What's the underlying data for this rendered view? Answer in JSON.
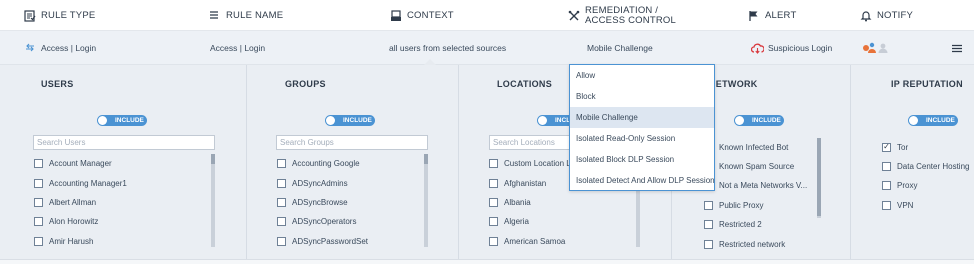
{
  "header": {
    "rule_type": "RULE TYPE",
    "rule_name": "RULE NAME",
    "context": "CONTEXT",
    "remediation_line1": "REMEDIATION /",
    "remediation_line2": "ACCESS CONTROL",
    "alert": "ALERT",
    "notify": "NOTIFY"
  },
  "rule": {
    "type": "Access | Login",
    "name": "Access | Login",
    "context": "all users from selected sources",
    "remediation": "Mobile Challenge",
    "alert": "Suspicious Login"
  },
  "columns": {
    "users": {
      "title": "USERS",
      "toggle": "INCLUDE",
      "search_placeholder": "Search Users",
      "items": [
        {
          "label": "Account Manager",
          "checked": false
        },
        {
          "label": "Accounting Manager1",
          "checked": false
        },
        {
          "label": "Albert Allman",
          "checked": false
        },
        {
          "label": "Alon Horowitz",
          "checked": false
        },
        {
          "label": "Amir Harush",
          "checked": false
        }
      ]
    },
    "groups": {
      "title": "GROUPS",
      "toggle": "INCLUDE",
      "search_placeholder": "Search Groups",
      "items": [
        {
          "label": "Accounting Google",
          "checked": false
        },
        {
          "label": "ADSyncAdmins",
          "checked": false
        },
        {
          "label": "ADSyncBrowse",
          "checked": false
        },
        {
          "label": "ADSyncOperators",
          "checked": false
        },
        {
          "label": "ADSyncPasswordSet",
          "checked": false
        }
      ]
    },
    "locations": {
      "title": "LOCATIONS",
      "toggle": "INCLUDE",
      "search_placeholder": "Search Locations",
      "items": [
        {
          "label": "Custom Location L",
          "checked": false
        },
        {
          "label": "Afghanistan",
          "checked": false
        },
        {
          "label": "Albania",
          "checked": false
        },
        {
          "label": "Algeria",
          "checked": false
        },
        {
          "label": "American Samoa",
          "checked": false
        }
      ]
    },
    "network": {
      "title": "NETWORK",
      "toggle": "INCLUDE",
      "items": [
        {
          "label": "Known Infected Bot",
          "checked": false
        },
        {
          "label": "Known Spam Source",
          "checked": false
        },
        {
          "label": "Not a Meta Networks V...",
          "checked": false
        },
        {
          "label": "Public Proxy",
          "checked": false
        },
        {
          "label": "Restricted 2",
          "checked": false
        },
        {
          "label": "Restricted network",
          "checked": false
        }
      ]
    },
    "ip_reputation": {
      "title": "IP REPUTATION",
      "toggle": "INCLUDE",
      "items": [
        {
          "label": "Tor",
          "checked": true
        },
        {
          "label": "Data Center Hosting",
          "checked": false
        },
        {
          "label": "Proxy",
          "checked": false
        },
        {
          "label": "VPN",
          "checked": false
        }
      ]
    }
  },
  "remediation_dropdown": {
    "options": [
      "Allow",
      "Block",
      "Mobile Challenge",
      "Isolated Read-Only Session",
      "Isolated Block DLP Session",
      "Isolated Detect And Allow DLP Session"
    ],
    "selected": "Mobile Challenge"
  },
  "colors": {
    "accent": "#4b93d3",
    "panel_bg": "#eaeef3",
    "alert_icon": "#d9393e",
    "notify_icon": "#e8733a"
  }
}
